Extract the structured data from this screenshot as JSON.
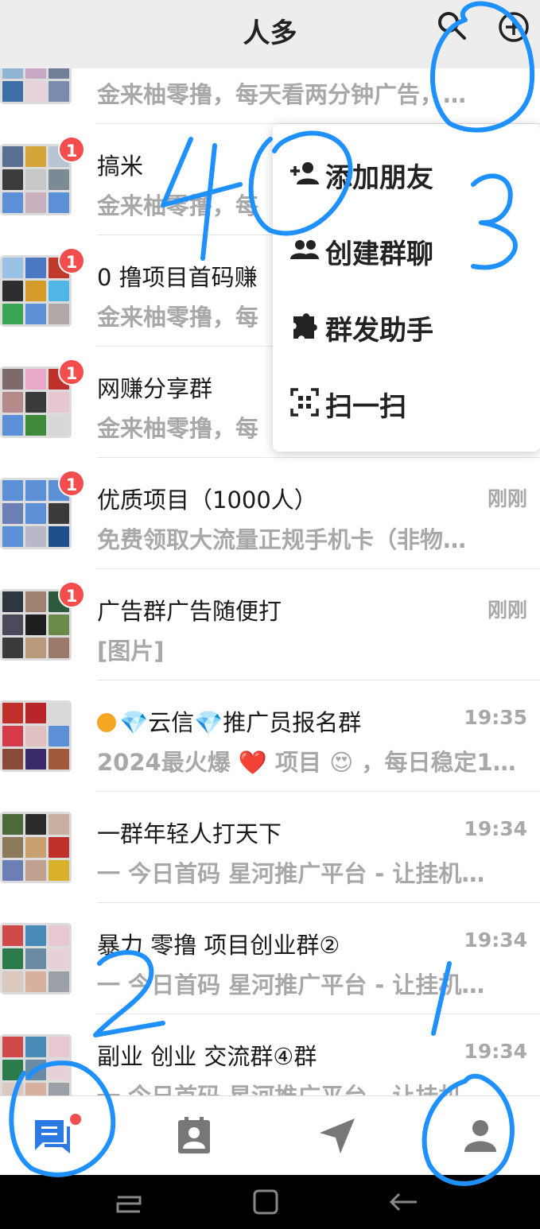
{
  "header": {
    "title": "人多",
    "search_icon": "search-icon",
    "add_icon": "plus-circle-icon"
  },
  "chats": [
    {
      "name": "",
      "message": "金来柚零撸，每天看两分钟广告，…",
      "time": "",
      "badge": ""
    },
    {
      "name": "搞米",
      "message": "金来柚零撸，每",
      "time": "",
      "badge": "1"
    },
    {
      "name": "0 撸项目首码赚",
      "message": "金来柚零撸，每",
      "time": "",
      "badge": "1"
    },
    {
      "name": "网赚分享群",
      "message": "金来柚零撸，每",
      "time": "",
      "badge": "1"
    },
    {
      "name": "优质项目（1000人）",
      "message": "免费领取大流量正规手机卡（非物…",
      "time": "刚刚",
      "badge": "1"
    },
    {
      "name": "广告群广告随便打",
      "message": "[图片]",
      "time": "刚刚",
      "badge": "1"
    },
    {
      "name": "💎云信💎推广员报名群",
      "message": "2024最火爆 ❤️ 项目 😍 ，每日稳定1…",
      "time": "19:35",
      "badge": ""
    },
    {
      "name": "一群年轻人打天下",
      "message": "一 今日首码 星河推广平台 - 让挂机…",
      "time": "19:34",
      "badge": ""
    },
    {
      "name": "暴力 零撸 项目创业群②",
      "message": "一 今日首码 星河推广平台 - 让挂机…",
      "time": "19:34",
      "badge": ""
    },
    {
      "name": "副业 创业 交流群④群",
      "message": "一 今日首码 星河推广平台 - 让挂机…",
      "time": "19:34",
      "badge": ""
    }
  ],
  "menu": {
    "items": [
      {
        "label": "添加朋友",
        "icon": "add-person-icon"
      },
      {
        "label": "创建群聊",
        "icon": "group-icon"
      },
      {
        "label": "群发助手",
        "icon": "puzzle-icon"
      },
      {
        "label": "扫一扫",
        "icon": "scan-icon"
      }
    ]
  },
  "tabbar": {
    "tabs": [
      {
        "name": "chats",
        "icon": "chat-icon",
        "active": true,
        "has_dot": true
      },
      {
        "name": "contacts",
        "icon": "contacts-icon",
        "active": false
      },
      {
        "name": "discover",
        "icon": "send-icon",
        "active": false
      },
      {
        "name": "me",
        "icon": "person-icon",
        "active": false
      }
    ]
  },
  "annotations": {
    "numbers": [
      "4",
      "0",
      "3",
      "2",
      "1"
    ],
    "pen_color": "#1e90ff"
  },
  "colors": {
    "accent": "#2c7be5",
    "badge": "#f34d4d",
    "header_bg": "#ededed",
    "muted_text": "#a8a8a8"
  }
}
